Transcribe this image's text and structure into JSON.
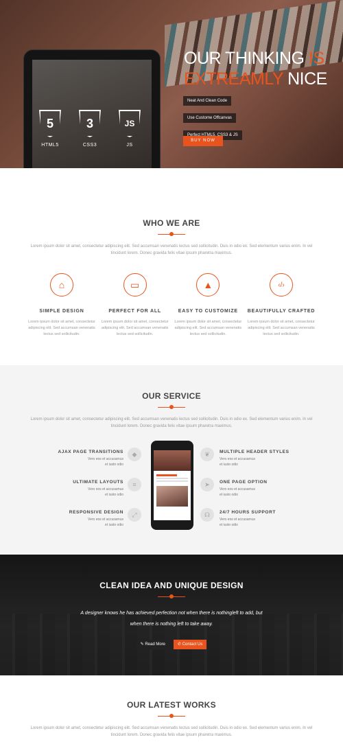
{
  "hero": {
    "title_line1_white": "OUR THINKING ",
    "title_line1_accent": "IS",
    "title_line2_accent": "EXTREAMLY",
    "title_line2_white": " NICE",
    "features": [
      "Neat And Clean Code",
      "Use Custome Offcanvas",
      "Perfect HTML5, CSS3 & JS"
    ],
    "buy_button": "BUY NOW",
    "tech": [
      {
        "label": "HTML5",
        "glyph": "5"
      },
      {
        "label": "CSS3",
        "glyph": "3"
      },
      {
        "label": "JS",
        "glyph": "JS"
      }
    ]
  },
  "who": {
    "title": "WHO WE ARE",
    "lead": "Lorem ipsum dolor sit amet, consectetur adipiscing elit. Sed accumsan venenatis lectus sed sollicitudin. Duis in odio ex. Sed elementum varius enim. In vel tincidunt lorem. Donec gravida felis vitae ipsum pharetra maximus.",
    "items": [
      {
        "icon": "android-icon",
        "glyph": "⌂",
        "title": "SIMPLE DESIGN",
        "text": "Lorem ipsum dolor sit amet, consectetur adipiscing elit. Sed accumsan venenatis lectus sed sollicitudin."
      },
      {
        "icon": "laptop-icon",
        "glyph": "▭",
        "title": "PERFECT FOR ALL",
        "text": "Lorem ipsum dolor sit amet, consectetur adipiscing elit. Sed accumsan venenatis lectus sed sollicitudin."
      },
      {
        "icon": "rocket-icon",
        "glyph": "▲",
        "title": "EASY TO CUSTOMIZE",
        "text": "Lorem ipsum dolor sit amet, consectetur adipiscing elit. Sed accumsan venenatis lectus sed sollicitudin."
      },
      {
        "icon": "code-icon",
        "glyph": "‹/›",
        "title": "BEAUTIFULLY CRAFTED",
        "text": "Lorem ipsum dolor sit amet, consectetur adipiscing elit. Sed accumsan venenatis lectus sed sollicitudin."
      }
    ]
  },
  "service": {
    "title": "OUR SERVICE",
    "lead": "Lorem ipsum dolor sit amet, consectetur adipiscing elit. Sed accumsan venenatis lectus sed sollicitudin. Duis in odio ex. Sed elementum varius enim. In vel tincidunt lorem. Donec gravida felis vitae ipsum pharetra maximus.",
    "left": [
      {
        "title": "AJAX PAGE TRANSITIONS",
        "text": "Vero eos et accusamus et iusto odio",
        "icon": "drop-icon",
        "glyph": "◆"
      },
      {
        "title": "ULTIMATE LAYOUTS",
        "text": "Vero eos et accusamus et iusto odio",
        "icon": "database-icon",
        "glyph": "≡"
      },
      {
        "title": "RESPONSIVE DESIGN",
        "text": "Vero eos et accusamus et iusto odio",
        "icon": "resize-icon",
        "glyph": "⤢"
      }
    ],
    "right": [
      {
        "title": "MULTIPLE HEADER STYLES",
        "text": "Vero eos et accusamus et iusto odio",
        "icon": "leaf-icon",
        "glyph": "❦"
      },
      {
        "title": "ONE PAGE OPTION",
        "text": "Vero eos et accusamus et iusto odio",
        "icon": "send-icon",
        "glyph": "➤"
      },
      {
        "title": "24/7 HOURS SUPPORT",
        "text": "Vero eos et accusamus et iusto odio",
        "icon": "headset-icon",
        "glyph": "☊"
      }
    ]
  },
  "quote": {
    "title": "CLEAN IDEA AND UNIQUE DESIGN",
    "text_line1": "A designer knows he has achieved perfection not when there is nothingleft to add, but",
    "text_line2": "when there is nothing left to take away.",
    "read_more": "✎ Read More",
    "contact": "✆ Contact Us"
  },
  "works": {
    "title": "OUR LATEST WORKS",
    "lead": "Lorem ipsum dolor sit amet, consectetur adipiscing elit. Sed accumsan venenatis lectus sed sollicitudin. Duis in odio ex. Sed elementum varius enim. In vel tincidunt lorem. Donec gravida felis vitae ipsum pharetra maximus."
  },
  "colors": {
    "accent": "#e8531e",
    "dark": "#1a1a1a",
    "light_bg": "#f4f4f4"
  }
}
